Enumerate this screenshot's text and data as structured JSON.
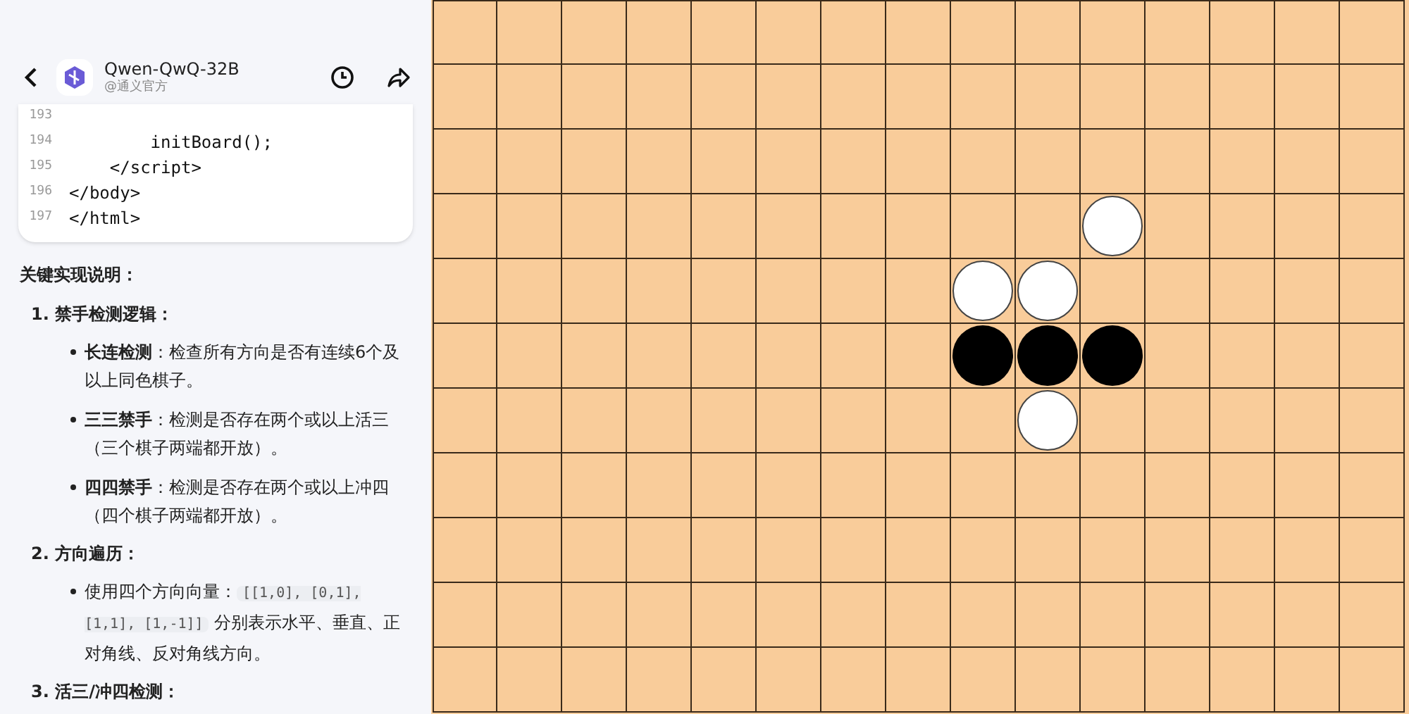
{
  "header": {
    "title": "Qwen-QwQ-32B",
    "subtitle": "@通义官方"
  },
  "code": {
    "lines": [
      {
        "number": "193"
      },
      {
        "number": "194",
        "text": "        initBoard();"
      },
      {
        "number": "195",
        "text": "    </script>"
      },
      {
        "number": "196",
        "text": "</body>"
      },
      {
        "number": "197",
        "text": "</html>"
      }
    ]
  },
  "explanation": {
    "heading": "关键实现说明：",
    "sections": [
      {
        "number": "1.",
        "title": "禁手检测逻辑：",
        "bullets": [
          {
            "parts": [
              {
                "kind": "bold",
                "text": "长连检测"
              },
              {
                "kind": "text",
                "text": "：检查所有方向是否有连续6个及以上同色棋子。"
              }
            ]
          },
          {
            "parts": [
              {
                "kind": "bold",
                "text": "三三禁手"
              },
              {
                "kind": "text",
                "text": "：检测是否存在两个或以上活三（三个棋子两端都开放）。"
              }
            ]
          },
          {
            "parts": [
              {
                "kind": "bold",
                "text": "四四禁手"
              },
              {
                "kind": "text",
                "text": "：检测是否存在两个或以上冲四（四个棋子两端都开放）。"
              }
            ]
          }
        ]
      },
      {
        "number": "2.",
        "title": "方向遍历：",
        "bullets": [
          {
            "parts": [
              {
                "kind": "text",
                "text": "使用四个方向向量："
              },
              {
                "kind": "code",
                "text": "[[1,0], [0,1], [1,1], [1,-1]]"
              },
              {
                "kind": "text",
                "text": " 分别表示水平、垂直、正对角线、反对角线方向。"
              }
            ]
          }
        ]
      },
      {
        "number": "3.",
        "title": "活三/冲四检测："
      }
    ]
  },
  "board": {
    "rows": [
      {
        "cells": [
          {
            "kind": "empty"
          },
          {
            "kind": "empty"
          },
          {
            "kind": "empty"
          },
          {
            "kind": "empty"
          },
          {
            "kind": "empty"
          },
          {
            "kind": "empty"
          },
          {
            "kind": "empty"
          },
          {
            "kind": "empty"
          },
          {
            "kind": "empty"
          },
          {
            "kind": "empty"
          },
          {
            "kind": "empty"
          },
          {
            "kind": "empty"
          },
          {
            "kind": "empty"
          },
          {
            "kind": "empty"
          },
          {
            "kind": "empty"
          }
        ]
      },
      {
        "cells": [
          {
            "kind": "empty"
          },
          {
            "kind": "empty"
          },
          {
            "kind": "empty"
          },
          {
            "kind": "empty"
          },
          {
            "kind": "empty"
          },
          {
            "kind": "empty"
          },
          {
            "kind": "empty"
          },
          {
            "kind": "empty"
          },
          {
            "kind": "empty"
          },
          {
            "kind": "empty"
          },
          {
            "kind": "empty"
          },
          {
            "kind": "empty"
          },
          {
            "kind": "empty"
          },
          {
            "kind": "empty"
          },
          {
            "kind": "empty"
          }
        ]
      },
      {
        "cells": [
          {
            "kind": "empty"
          },
          {
            "kind": "empty"
          },
          {
            "kind": "empty"
          },
          {
            "kind": "empty"
          },
          {
            "kind": "empty"
          },
          {
            "kind": "empty"
          },
          {
            "kind": "empty"
          },
          {
            "kind": "empty"
          },
          {
            "kind": "empty"
          },
          {
            "kind": "empty"
          },
          {
            "kind": "empty"
          },
          {
            "kind": "empty"
          },
          {
            "kind": "empty"
          },
          {
            "kind": "empty"
          },
          {
            "kind": "empty"
          }
        ]
      },
      {
        "cells": [
          {
            "kind": "empty"
          },
          {
            "kind": "empty"
          },
          {
            "kind": "empty"
          },
          {
            "kind": "empty"
          },
          {
            "kind": "empty"
          },
          {
            "kind": "empty"
          },
          {
            "kind": "empty"
          },
          {
            "kind": "empty"
          },
          {
            "kind": "empty"
          },
          {
            "kind": "empty"
          },
          {
            "kind": "white"
          },
          {
            "kind": "empty"
          },
          {
            "kind": "empty"
          },
          {
            "kind": "empty"
          },
          {
            "kind": "empty"
          }
        ]
      },
      {
        "cells": [
          {
            "kind": "empty"
          },
          {
            "kind": "empty"
          },
          {
            "kind": "empty"
          },
          {
            "kind": "empty"
          },
          {
            "kind": "empty"
          },
          {
            "kind": "empty"
          },
          {
            "kind": "empty"
          },
          {
            "kind": "empty"
          },
          {
            "kind": "white"
          },
          {
            "kind": "white"
          },
          {
            "kind": "empty"
          },
          {
            "kind": "empty"
          },
          {
            "kind": "empty"
          },
          {
            "kind": "empty"
          },
          {
            "kind": "empty"
          }
        ]
      },
      {
        "cells": [
          {
            "kind": "empty"
          },
          {
            "kind": "empty"
          },
          {
            "kind": "empty"
          },
          {
            "kind": "empty"
          },
          {
            "kind": "empty"
          },
          {
            "kind": "empty"
          },
          {
            "kind": "empty"
          },
          {
            "kind": "empty"
          },
          {
            "kind": "black"
          },
          {
            "kind": "black"
          },
          {
            "kind": "black"
          },
          {
            "kind": "empty"
          },
          {
            "kind": "empty"
          },
          {
            "kind": "empty"
          },
          {
            "kind": "empty"
          }
        ]
      },
      {
        "cells": [
          {
            "kind": "empty"
          },
          {
            "kind": "empty"
          },
          {
            "kind": "empty"
          },
          {
            "kind": "empty"
          },
          {
            "kind": "empty"
          },
          {
            "kind": "empty"
          },
          {
            "kind": "empty"
          },
          {
            "kind": "empty"
          },
          {
            "kind": "empty"
          },
          {
            "kind": "white"
          },
          {
            "kind": "empty"
          },
          {
            "kind": "empty"
          },
          {
            "kind": "empty"
          },
          {
            "kind": "empty"
          },
          {
            "kind": "empty"
          }
        ]
      },
      {
        "cells": [
          {
            "kind": "empty"
          },
          {
            "kind": "empty"
          },
          {
            "kind": "empty"
          },
          {
            "kind": "empty"
          },
          {
            "kind": "empty"
          },
          {
            "kind": "empty"
          },
          {
            "kind": "empty"
          },
          {
            "kind": "empty"
          },
          {
            "kind": "empty"
          },
          {
            "kind": "empty"
          },
          {
            "kind": "empty"
          },
          {
            "kind": "empty"
          },
          {
            "kind": "empty"
          },
          {
            "kind": "empty"
          },
          {
            "kind": "empty"
          }
        ]
      },
      {
        "cells": [
          {
            "kind": "empty"
          },
          {
            "kind": "empty"
          },
          {
            "kind": "empty"
          },
          {
            "kind": "empty"
          },
          {
            "kind": "empty"
          },
          {
            "kind": "empty"
          },
          {
            "kind": "empty"
          },
          {
            "kind": "empty"
          },
          {
            "kind": "empty"
          },
          {
            "kind": "empty"
          },
          {
            "kind": "empty"
          },
          {
            "kind": "empty"
          },
          {
            "kind": "empty"
          },
          {
            "kind": "empty"
          },
          {
            "kind": "empty"
          }
        ]
      },
      {
        "cells": [
          {
            "kind": "empty"
          },
          {
            "kind": "empty"
          },
          {
            "kind": "empty"
          },
          {
            "kind": "empty"
          },
          {
            "kind": "empty"
          },
          {
            "kind": "empty"
          },
          {
            "kind": "empty"
          },
          {
            "kind": "empty"
          },
          {
            "kind": "empty"
          },
          {
            "kind": "empty"
          },
          {
            "kind": "empty"
          },
          {
            "kind": "empty"
          },
          {
            "kind": "empty"
          },
          {
            "kind": "empty"
          },
          {
            "kind": "empty"
          }
        ]
      },
      {
        "cells": [
          {
            "kind": "empty"
          },
          {
            "kind": "empty"
          },
          {
            "kind": "empty"
          },
          {
            "kind": "empty"
          },
          {
            "kind": "empty"
          },
          {
            "kind": "empty"
          },
          {
            "kind": "empty"
          },
          {
            "kind": "empty"
          },
          {
            "kind": "empty"
          },
          {
            "kind": "empty"
          },
          {
            "kind": "empty"
          },
          {
            "kind": "empty"
          },
          {
            "kind": "empty"
          },
          {
            "kind": "empty"
          },
          {
            "kind": "empty"
          }
        ]
      }
    ]
  }
}
